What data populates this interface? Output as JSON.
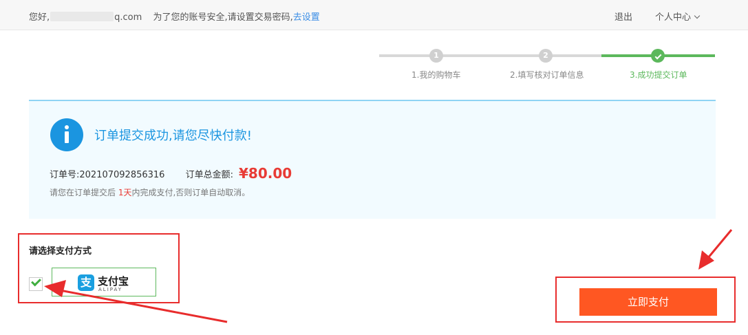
{
  "topbar": {
    "greeting_prefix": "您好,",
    "email_suffix": "q.com",
    "notice": "为了您的账号安全,请设置交易密码,",
    "set_link": "去设置",
    "logout": "退出",
    "user_center": "个人中心"
  },
  "steps": [
    {
      "num": "1",
      "label": "1.我的购物车",
      "status": "pending"
    },
    {
      "num": "2",
      "label": "2.填写核对订单信息",
      "status": "pending"
    },
    {
      "num": "",
      "label": "3.成功提交订单",
      "status": "done"
    }
  ],
  "success": {
    "title": "订单提交成功,请您尽快付款!",
    "order_no_label": "订单号:",
    "order_no": "202107092856316",
    "total_label": "订单总金额:",
    "amount": "¥80.00",
    "note_prefix": "请您在订单提交后 ",
    "note_highlight": "1天",
    "note_suffix": "内完成支付,否则订单自动取消。"
  },
  "payment": {
    "title": "请选择支付方式",
    "method_name": "支付宝",
    "method_sub": "ALIPAY",
    "logo_glyph": "支",
    "selected": true
  },
  "pay_button": "立即支付",
  "colors": {
    "accent_blue": "#1b95e0",
    "success_green": "#5cb85c",
    "price_red": "#e83b35",
    "pay_orange": "#ff5722",
    "highlight_red": "#e82c2c"
  }
}
